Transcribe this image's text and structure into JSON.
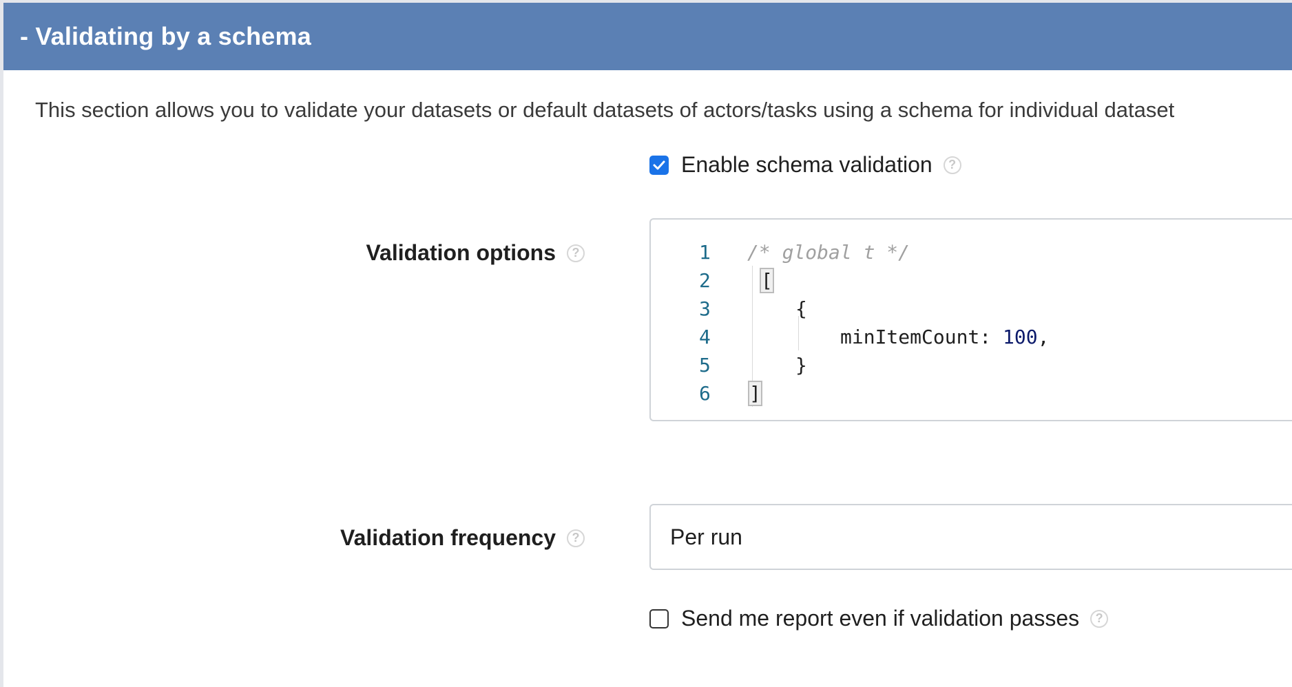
{
  "section": {
    "title": "- Validating by a schema",
    "description": "This section allows you to validate your datasets or default datasets of actors/tasks using a schema for individual dataset"
  },
  "enable_validation": {
    "label": "Enable schema validation",
    "checked": true,
    "help_icon": "question-circle-icon"
  },
  "validation_options": {
    "label": "Validation options",
    "help_icon": "question-circle-icon",
    "editor": {
      "lines": [
        {
          "number": "1",
          "text": "/* global t */"
        },
        {
          "number": "2",
          "text": "["
        },
        {
          "number": "3",
          "text": "{"
        },
        {
          "number": "4",
          "key": "minItemCount: ",
          "value": "100",
          "suffix": ","
        },
        {
          "number": "5",
          "text": "}"
        },
        {
          "number": "6",
          "text": "]"
        }
      ]
    }
  },
  "validation_frequency": {
    "label": "Validation frequency",
    "value": "Per run",
    "help_icon": "question-circle-icon"
  },
  "send_report": {
    "label": "Send me report even if validation passes",
    "checked": false,
    "help_icon": "question-circle-icon"
  },
  "colors": {
    "header_bg": "#5b80b4",
    "checkbox_accent": "#1a73e8",
    "line_number": "#1d6b8a"
  }
}
